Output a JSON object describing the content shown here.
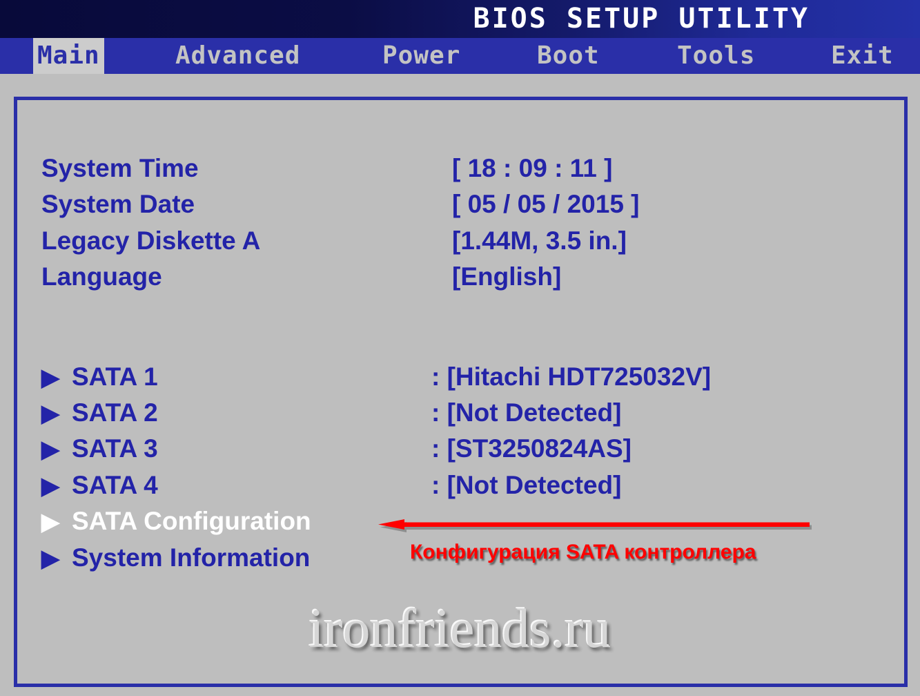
{
  "window": {
    "title": "BIOS SETUP UTILITY",
    "background_color": "#bebebe",
    "accent_color": "#2a2fa8",
    "text_color": "#2323a8",
    "highlight_text_color": "#ffffff",
    "annotation_color": "#ff0000"
  },
  "menubar": {
    "tabs": [
      {
        "label": "Main",
        "selected": true
      },
      {
        "label": "Advanced",
        "selected": false
      },
      {
        "label": "Power",
        "selected": false
      },
      {
        "label": "Boot",
        "selected": false
      },
      {
        "label": "Tools",
        "selected": false
      },
      {
        "label": "Exit",
        "selected": false
      }
    ]
  },
  "main": {
    "settings": [
      {
        "label": "System Time",
        "value": "[ 18 : 09 : 11 ]"
      },
      {
        "label": "System Date",
        "value": "[ 05 / 05 / 2015 ]"
      },
      {
        "label": "Legacy Diskette A",
        "value": "[1.44M, 3.5 in.]"
      },
      {
        "label": "Language",
        "value": "[English]"
      }
    ],
    "submenus": [
      {
        "arrow": "▶",
        "label": "SATA 1",
        "value": ": [Hitachi HDT725032V]",
        "highlighted": false
      },
      {
        "arrow": "▶",
        "label": "SATA 2",
        "value": ": [Not Detected]",
        "highlighted": false
      },
      {
        "arrow": "▶",
        "label": "SATA 3",
        "value": ": [ST3250824AS]",
        "highlighted": false
      },
      {
        "arrow": "▶",
        "label": "SATA 4",
        "value": ": [Not Detected]",
        "highlighted": false
      },
      {
        "arrow": "▶",
        "label": "SATA Configuration",
        "value": "",
        "highlighted": true
      },
      {
        "arrow": "▶",
        "label": "System Information",
        "value": "",
        "highlighted": false
      }
    ]
  },
  "annotation": {
    "text": "Конфигурация SATA контроллера",
    "arrow_direction": "left",
    "points_to": "SATA Configuration"
  },
  "watermark": {
    "text": "ironfriends.ru"
  }
}
